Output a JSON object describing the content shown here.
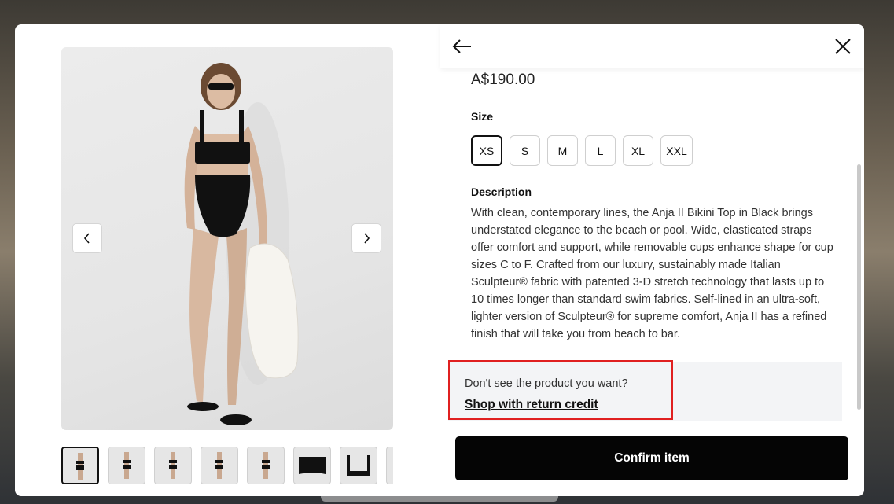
{
  "product": {
    "price": "A$190.00",
    "size_heading": "Size",
    "sizes": [
      "XS",
      "S",
      "M",
      "L",
      "XL",
      "XXL"
    ],
    "selected_size": "XS",
    "description_heading": "Description",
    "description": "With clean, contemporary lines, the Anja II Bikini Top in Black brings understated elegance to the beach or pool. Wide, elasticated straps offer comfort and support, while removable cups enhance shape for cup sizes C to F. Crafted from our luxury, sustainably made Italian Sculpteur® fabric with patented 3-D stretch technology that lasts up to 10 times longer than standard swim fabrics. Self-lined in an ultra-soft, lighter version of Sculpteur® for supreme comfort, Anja II has a refined finish that will take you from beach to bar."
  },
  "credit": {
    "question": "Don't see the product you want?",
    "link": "Shop with return credit"
  },
  "actions": {
    "confirm": "Confirm item"
  },
  "icons": {
    "back": "arrow-left-icon",
    "close": "close-icon",
    "prev": "chevron-left-icon",
    "next": "chevron-right-icon"
  },
  "gallery": {
    "thumbnail_count": 8,
    "active_index": 0
  }
}
